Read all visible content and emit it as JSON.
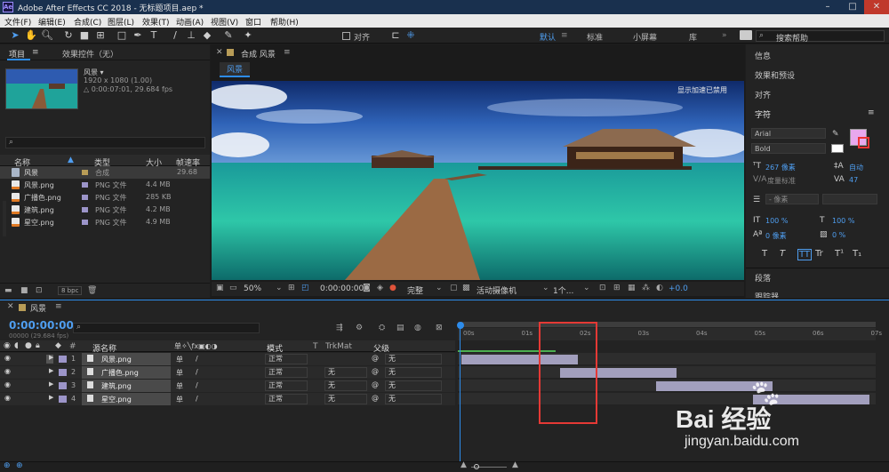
{
  "window": {
    "title": "Adobe After Effects CC 2018 - 无标题项目.aep *",
    "app_icon": "Ae"
  },
  "menu": [
    "文件(F)",
    "编辑(E)",
    "合成(C)",
    "图层(L)",
    "效果(T)",
    "动画(A)",
    "视图(V)",
    "窗口",
    "帮助(H)"
  ],
  "toolbar": {
    "snap_label": "对齐",
    "workspaces": [
      "默认",
      "标准",
      "小屏幕",
      "库"
    ],
    "search_placeholder": "搜索帮助"
  },
  "project": {
    "tab": "项目",
    "effects_tab": "效果控件（无）",
    "comp_name": "风景 ▾",
    "resolution": "1920 x 1080 (1.00)",
    "duration": "△ 0:00:07:01, 29.684 fps",
    "columns": [
      "名称",
      "类型",
      "大小",
      "帧速率"
    ],
    "items": [
      {
        "name": "风景",
        "type": "合成",
        "size": "",
        "fps": "29.68"
      },
      {
        "name": "风景.png",
        "type": "PNG 文件",
        "size": "4.4 MB",
        "fps": ""
      },
      {
        "name": "广播色.png",
        "type": "PNG 文件",
        "size": "285 KB",
        "fps": ""
      },
      {
        "name": "建筑.png",
        "type": "PNG 文件",
        "size": "4.2 MB",
        "fps": ""
      },
      {
        "name": "星空.png",
        "type": "PNG 文件",
        "size": "4.9 MB",
        "fps": ""
      }
    ],
    "bpc": "8 bpc"
  },
  "viewer": {
    "header": "合成 风景",
    "tab": "风景",
    "notice": "显示加速已禁用",
    "zoom": "50%",
    "timecode": "0:00:00:00",
    "quality": "完整",
    "camera": "活动摄像机",
    "views": "1个...",
    "exposure": "+0.0"
  },
  "right_panel": {
    "sections": [
      "信息",
      "效果和预设",
      "对齐",
      "字符"
    ],
    "font": "Arial",
    "style": "Bold",
    "leading": "267 像素",
    "kerning": "度量标准",
    "tracking": "47",
    "auto_label": "自动",
    "stroke": "- 像素",
    "vscale": "100 %",
    "hscale": "100 %",
    "baseline": "0 像素",
    "tsume": "0 %",
    "style_buttons": [
      "T",
      "T",
      "TT",
      "Tr",
      "T¹",
      "T₁"
    ],
    "paragraph": "段落",
    "tracker": "跟踪器"
  },
  "timeline": {
    "comp_tab": "风景",
    "timecode": "0:00:00:00",
    "fps_info": "00000 (29.684 fps)",
    "headers": {
      "source": "源名称",
      "mode": "模式",
      "t": "T",
      "trkmat": "TrkMat",
      "parent": "父级"
    },
    "ruler": [
      "00s",
      "01s",
      "02s",
      "03s",
      "04s",
      "05s",
      "06s",
      "07s"
    ],
    "layers": [
      {
        "num": "1",
        "name": "风景.png",
        "mode": "正常",
        "trkmat": "",
        "parent": "无",
        "start": 0.0,
        "end": 2.0
      },
      {
        "num": "2",
        "name": "广播色.png",
        "mode": "正常",
        "trkmat": "无",
        "parent": "无",
        "start": 1.7,
        "end": 3.7
      },
      {
        "num": "3",
        "name": "建筑.png",
        "mode": "正常",
        "trkmat": "无",
        "parent": "无",
        "start": 3.35,
        "end": 5.35
      },
      {
        "num": "4",
        "name": "星空.png",
        "mode": "正常",
        "trkmat": "无",
        "parent": "无",
        "start": 5.0,
        "end": 7.0
      }
    ]
  },
  "watermark": {
    "brand": "Bai 经验",
    "url": "jingyan.baidu.com"
  },
  "colors": {
    "accent": "#2d8ceb",
    "layer_bar": "#a29fbd",
    "highlight_box": "#e53935",
    "title_bar": "#19304e"
  }
}
